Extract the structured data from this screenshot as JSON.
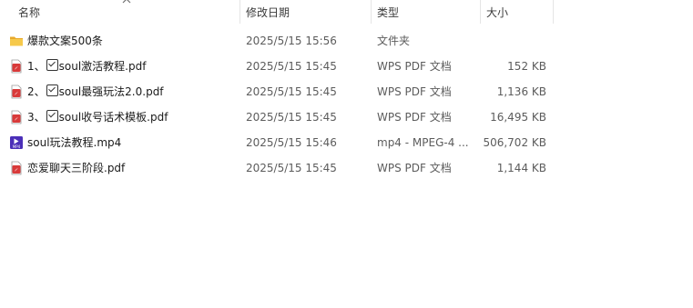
{
  "columns": {
    "name": "名称",
    "date": "修改日期",
    "type": "类型",
    "size": "大小"
  },
  "files": [
    {
      "icon": "folder-icon",
      "prefix": "爆款文案500条",
      "checked": false,
      "name": "",
      "date": "2025/5/15 15:56",
      "type": "文件夹",
      "size": ""
    },
    {
      "icon": "pdf-icon",
      "prefix": "1、",
      "checked": true,
      "name": "soul激活教程.pdf",
      "date": "2025/5/15 15:45",
      "type": "WPS PDF 文档",
      "size": "152 KB"
    },
    {
      "icon": "pdf-icon",
      "prefix": "2、",
      "checked": true,
      "name": "soul最强玩法2.0.pdf",
      "date": "2025/5/15 15:45",
      "type": "WPS PDF 文档",
      "size": "1,136 KB"
    },
    {
      "icon": "pdf-icon",
      "prefix": "3、",
      "checked": true,
      "name": "soul收号话术模板.pdf",
      "date": "2025/5/15 15:45",
      "type": "WPS PDF 文档",
      "size": "16,495 KB"
    },
    {
      "icon": "mp4-icon",
      "prefix": "soul玩法教程.mp4",
      "checked": false,
      "name": "",
      "date": "2025/5/15 15:46",
      "type": "mp4 - MPEG-4 ...",
      "size": "506,702 KB"
    },
    {
      "icon": "pdf-icon",
      "prefix": "恋爱聊天三阶段.pdf",
      "checked": false,
      "name": "",
      "date": "2025/5/15 15:45",
      "type": "WPS PDF 文档",
      "size": "1,144 KB"
    }
  ],
  "colors": {
    "folder": "#f4c542",
    "pdf": "#d93a3a",
    "mp4": "#4b2fb8"
  }
}
